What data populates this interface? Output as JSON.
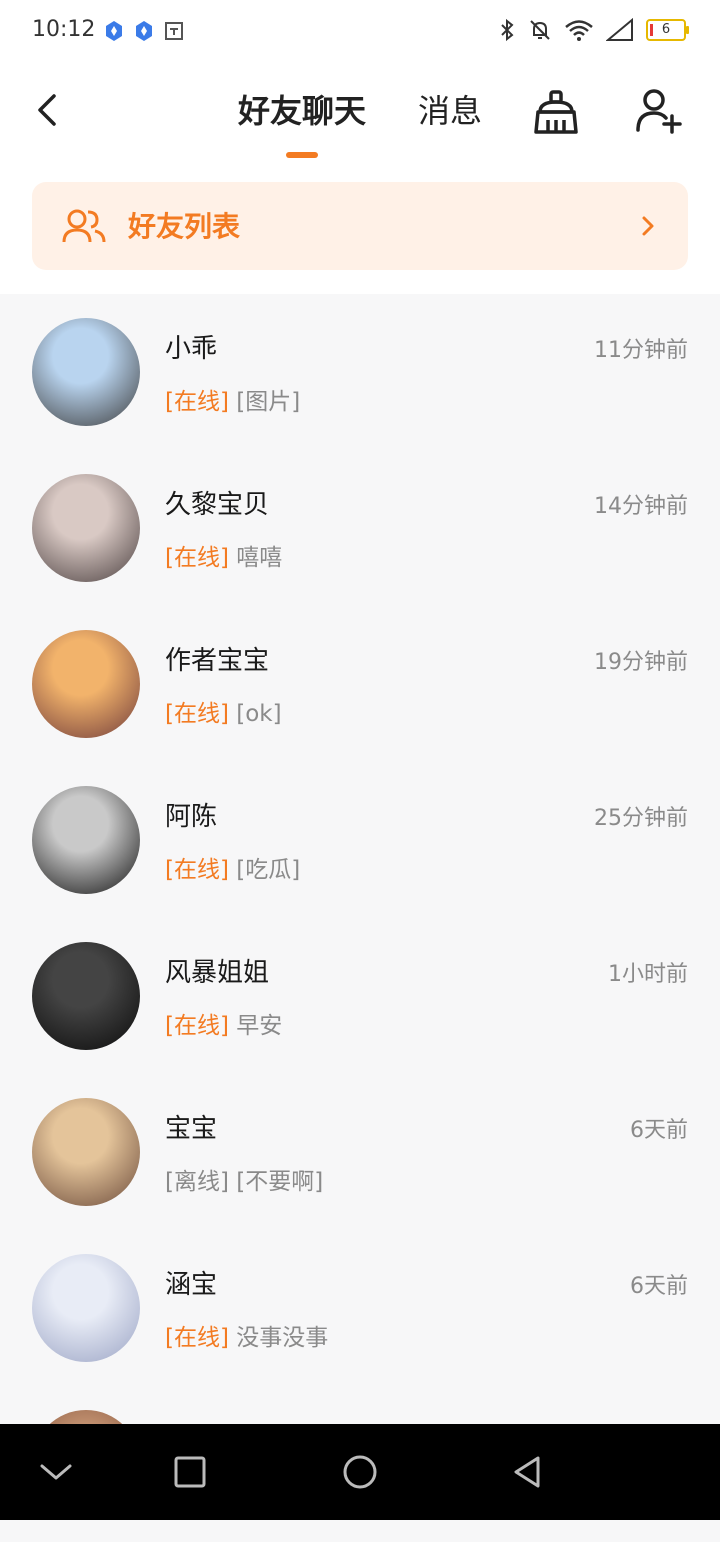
{
  "status_bar": {
    "time": "10:12",
    "battery_level": "6"
  },
  "header": {
    "tab_friends_chat": "好友聊天",
    "tab_messages": "消息"
  },
  "friend_list_banner": {
    "label": "好友列表"
  },
  "chats": [
    {
      "name": "小乖",
      "time": "11分钟前",
      "status": "[在线]",
      "online": true,
      "preview": "[图片]",
      "avatar_colors": [
        "#b9d4ef",
        "#3b3b3b"
      ]
    },
    {
      "name": "久黎宝贝",
      "time": "14分钟前",
      "status": "[在线]",
      "online": true,
      "preview": "嘻嘻",
      "avatar_colors": [
        "#d9c9c4",
        "#4a3f3f"
      ]
    },
    {
      "name": "作者宝宝",
      "time": "19分钟前",
      "status": "[在线]",
      "online": true,
      "preview": "[ok]",
      "avatar_colors": [
        "#f2b36b",
        "#6f3a3a"
      ]
    },
    {
      "name": "阿陈",
      "time": "25分钟前",
      "status": "[在线]",
      "online": true,
      "preview": "[吃瓜]",
      "avatar_colors": [
        "#c9c9c9",
        "#111111"
      ]
    },
    {
      "name": "风暴姐姐",
      "time": "1小时前",
      "status": "[在线]",
      "online": true,
      "preview": "早安",
      "avatar_colors": [
        "#444444",
        "#0a0a0a"
      ]
    },
    {
      "name": "宝宝",
      "time": "6天前",
      "status": "[离线]",
      "online": false,
      "preview": "[不要啊]",
      "avatar_colors": [
        "#e4c49a",
        "#6b4a3a"
      ]
    },
    {
      "name": "涵宝",
      "time": "6天前",
      "status": "[在线]",
      "online": true,
      "preview": "没事没事",
      "avatar_colors": [
        "#e8ecf6",
        "#9aa3c4"
      ]
    }
  ],
  "colors": {
    "accent": "#f37b22",
    "banner_bg": "#fff1e7",
    "list_bg": "#f7f7f8"
  }
}
